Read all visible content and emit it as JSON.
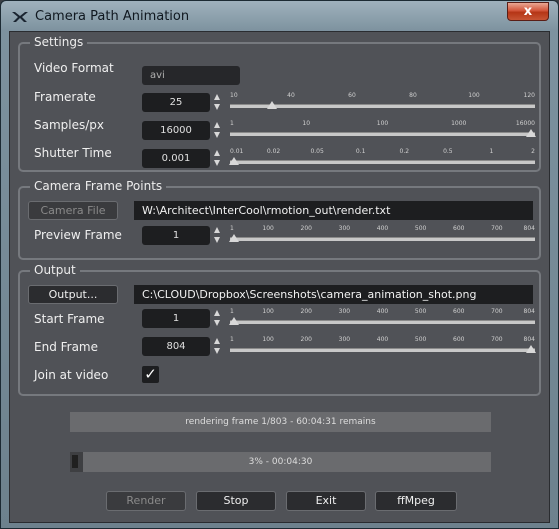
{
  "window": {
    "title": "Camera Path Animation",
    "close_glyph": "x"
  },
  "settings": {
    "title": "Settings",
    "video_format": {
      "label": "Video Format",
      "value": "avi"
    },
    "framerate": {
      "label": "Framerate",
      "value": "25",
      "ticks": [
        "10",
        "40",
        "60",
        "80",
        "100",
        "120"
      ],
      "range": [
        10,
        120
      ],
      "current": 25
    },
    "samples": {
      "label": "Samples/px",
      "value": "16000",
      "ticks": [
        "1",
        "10",
        "100",
        "1000",
        "16000"
      ],
      "current_fraction": 1.0
    },
    "shutter": {
      "label": "Shutter Time",
      "value": "0.001",
      "ticks": [
        "0.01",
        "0.02",
        "0.05",
        "0.1",
        "0.2",
        "0.5",
        "1",
        "2"
      ],
      "current_fraction": 0.0
    }
  },
  "camera_frame_points": {
    "title": "Camera Frame Points",
    "camera_file_button": "Camera File",
    "file_path": "W:\\Architect\\InterCool\\rmotion_out\\render.txt",
    "preview_frame": {
      "label": "Preview Frame",
      "value": "1",
      "ticks": [
        "1",
        "100",
        "200",
        "300",
        "400",
        "500",
        "600",
        "700",
        "804"
      ],
      "range": [
        1,
        804
      ],
      "current": 1
    }
  },
  "output": {
    "title": "Output",
    "output_button": "Output...",
    "file_path": "C:\\CLOUD\\Dropbox\\Screenshots\\camera_animation_shot.png",
    "start_frame": {
      "label": "Start Frame",
      "value": "1",
      "ticks": [
        "1",
        "100",
        "200",
        "300",
        "400",
        "500",
        "600",
        "700",
        "804"
      ],
      "range": [
        1,
        804
      ],
      "current": 1
    },
    "end_frame": {
      "label": "End Frame",
      "value": "804",
      "ticks": [
        "1",
        "100",
        "200",
        "300",
        "400",
        "500",
        "600",
        "700",
        "804"
      ],
      "range": [
        1,
        804
      ],
      "current": 804
    },
    "join_video": {
      "label": "Join at video",
      "checked": true,
      "check_glyph": "✓"
    }
  },
  "status": {
    "text": "rendering frame 1/803 - 60:04:31 remains"
  },
  "progress": {
    "text": "3% - 00:04:30",
    "fraction": 0.03
  },
  "buttons": {
    "render": "Render",
    "stop": "Stop",
    "exit": "Exit",
    "ffmpeg": "ffMpeg"
  },
  "colors": {
    "panel": "#505257",
    "field": "#1d1e20",
    "close": "#c7452a"
  }
}
